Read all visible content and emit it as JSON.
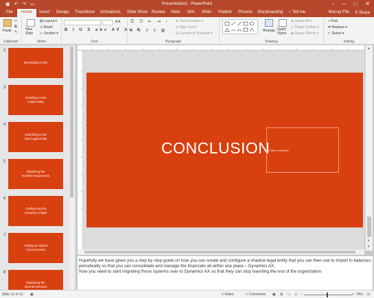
{
  "window": {
    "title": "Presentation2 - PowerPoint",
    "accent": "#b7472a",
    "slide_color": "#d84010"
  },
  "tabs": [
    {
      "label": "File"
    },
    {
      "label": "Home"
    },
    {
      "label": "Insert"
    },
    {
      "label": "Design"
    },
    {
      "label": "Transitions"
    },
    {
      "label": "Animations"
    },
    {
      "label": "Slide Show"
    },
    {
      "label": "Review"
    },
    {
      "label": "View"
    },
    {
      "label": "MIX"
    },
    {
      "label": "Write"
    },
    {
      "label": "Publish"
    },
    {
      "label": "Present"
    },
    {
      "label": "Storyboarding"
    },
    {
      "label": "Tell me"
    }
  ],
  "active_tab": "Home",
  "user": {
    "name": "Murray Fife",
    "share_label": "Share"
  },
  "ribbon": {
    "clipboard": {
      "label": "Clipboard",
      "paste": "Paste"
    },
    "slides": {
      "label": "Slides",
      "new_slide": "New Slide",
      "layout": "Layout",
      "reset": "Reset",
      "section": "Section"
    },
    "font": {
      "label": "Font"
    },
    "paragraph": {
      "label": "Paragraph",
      "text_direction": "Text Direction",
      "align_text": "Align Text",
      "convert_smartart": "Convert to SmartArt"
    },
    "drawing": {
      "label": "Drawing",
      "arrange": "Arrange",
      "quick_styles": "Quick Styles",
      "shape_fill": "Shape Fill",
      "shape_outline": "Shape Outline",
      "shape_effects": "Shape Effects"
    },
    "editing": {
      "label": "Editing",
      "find": "Find",
      "replace": "Replace",
      "select": "Select"
    }
  },
  "thumbnails": [
    {
      "number": "2",
      "text": "INTRODUCTION"
    },
    {
      "number": "3",
      "text": "Creating a new\nLegal Entity"
    },
    {
      "number": "4",
      "text": "Switching to the\nnew Legal Entity"
    },
    {
      "number": "5",
      "text": "Initializing the\nNumber Sequences"
    },
    {
      "number": "6",
      "text": "Configuring the\ncompany Ledger"
    },
    {
      "number": "7",
      "text": "Adding an Import\nJournal Name"
    },
    {
      "number": "8",
      "text": "Deploying the\nJournal Services"
    }
  ],
  "slide": {
    "title": "CONCLUSION",
    "placeholder": "Click to add text"
  },
  "notes": {
    "line1": "Hopefully we have given you a step by step guide on how you can create and configure a shadow legal entity that you can then use to import in balances periodically so that you can consolidate and manage the financials all within one place – Dynamics AX.",
    "line2": "Now you need to start migrating those systems over to Dynamics AX so that they can stop haunting the rest of the organization."
  },
  "status": {
    "slide_counter": "Slide 12 of 12",
    "notes": "Notes",
    "comments": "Comments",
    "zoom": "74%",
    "zoom_level": 0.48
  }
}
